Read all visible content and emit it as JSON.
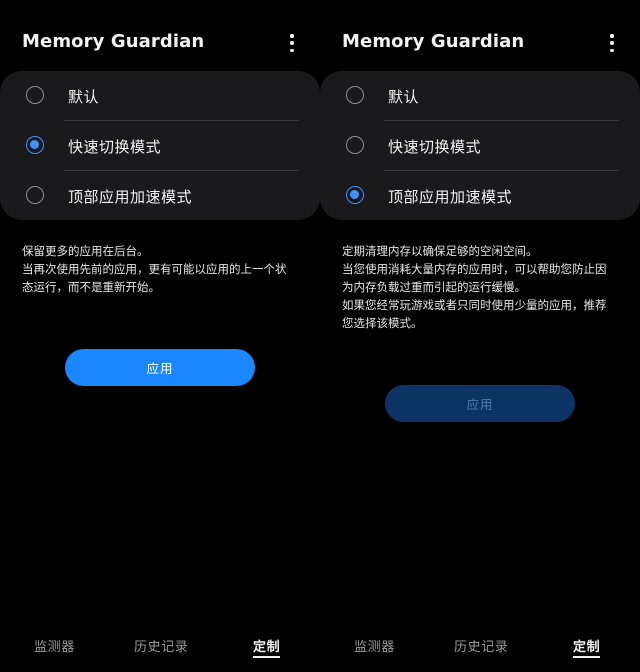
{
  "screens": [
    {
      "title": "Memory Guardian",
      "options": [
        {
          "label": "默认",
          "selected": false
        },
        {
          "label": "快速切换模式",
          "selected": true
        },
        {
          "label": "顶部应用加速模式",
          "selected": false
        }
      ],
      "description": [
        "保留更多的应用在后台。",
        "当再次使用先前的应用，更有可能以应用的上一个状",
        "态运行，而不是重新开始。"
      ],
      "apply_label": "应用",
      "apply_enabled": true,
      "nav": {
        "tabs": [
          "监测器",
          "历史记录",
          "定制"
        ],
        "active": "定制"
      }
    },
    {
      "title": "Memory Guardian",
      "options": [
        {
          "label": "默认",
          "selected": false
        },
        {
          "label": "快速切换模式",
          "selected": false
        },
        {
          "label": "顶部应用加速模式",
          "selected": true
        }
      ],
      "description": [
        "定期清理内存以确保足够的空闲空间。",
        "当您使用消耗大量内存的应用时，可以帮助您防止因",
        "为内存负载过重而引起的运行缓慢。",
        "如果您经常玩游戏或者只同时使用少量的应用，推荐",
        "您选择该模式。"
      ],
      "apply_label": "应用",
      "apply_enabled": false,
      "nav": {
        "tabs": [
          "监测器",
          "历史记录",
          "定制"
        ],
        "active": "定制"
      }
    }
  ],
  "colors": {
    "accent": "#3e91ff",
    "button_enabled": "#1b87ff",
    "button_disabled": "#0d3365",
    "card_bg": "#1a1a1c"
  },
  "icons": {
    "more": "more-vertical-icon",
    "radio_on": "radio-checked-icon",
    "radio_off": "radio-unchecked-icon"
  }
}
